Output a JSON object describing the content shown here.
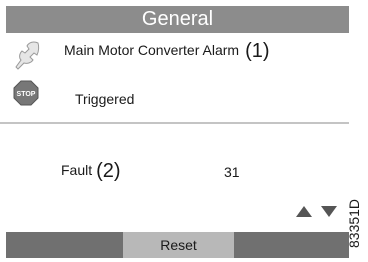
{
  "header": {
    "title": "General"
  },
  "alarm": {
    "message": "Main Motor Converter Alarm",
    "callout": "(1)",
    "status": "Triggered"
  },
  "fault": {
    "label": "Fault",
    "callout": "(2)",
    "value": "31"
  },
  "footer": {
    "reset_label": "Reset"
  },
  "figure_code": "83351D",
  "icons": {
    "alarm_type": "wrench-icon",
    "stop": "stop-sign-icon",
    "scroll_up": "arrow-up-icon",
    "scroll_down": "arrow-down-icon"
  },
  "colors": {
    "title_bar": "#8c8c8c",
    "bottom_bar": "#707070",
    "reset_button": "#b8b8b8",
    "stop_sign": "#777777"
  }
}
